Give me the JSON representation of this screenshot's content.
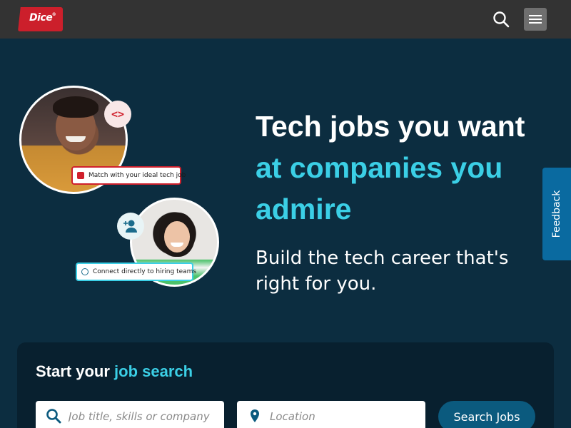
{
  "nav": {
    "logo_text": "Dice",
    "logo_mark": "®",
    "search_icon": "search-icon",
    "menu_icon": "hamburger-menu-icon"
  },
  "hero": {
    "title_line1": "Tech jobs you want",
    "title_accent": "at companies you admire",
    "subtitle": "Build the tech career that's right for you.",
    "tag_match": "Match with your ideal tech job",
    "tag_connect": "Connect directly to hiring teams",
    "code_bubble": "<>"
  },
  "feedback": {
    "label": "Feedback"
  },
  "search": {
    "heading_prefix": "Start your",
    "heading_accent": "job search",
    "keyword_placeholder": "Job title, skills or company",
    "location_placeholder": "Location",
    "submit_label": "Search Jobs"
  },
  "colors": {
    "background": "#0c2d40",
    "topbar": "#333333",
    "brand_red": "#cc1f2b",
    "accent_cyan": "#3bcfe6",
    "button_blue": "#0b5a7e",
    "feedback_blue": "#0a6aa0"
  }
}
